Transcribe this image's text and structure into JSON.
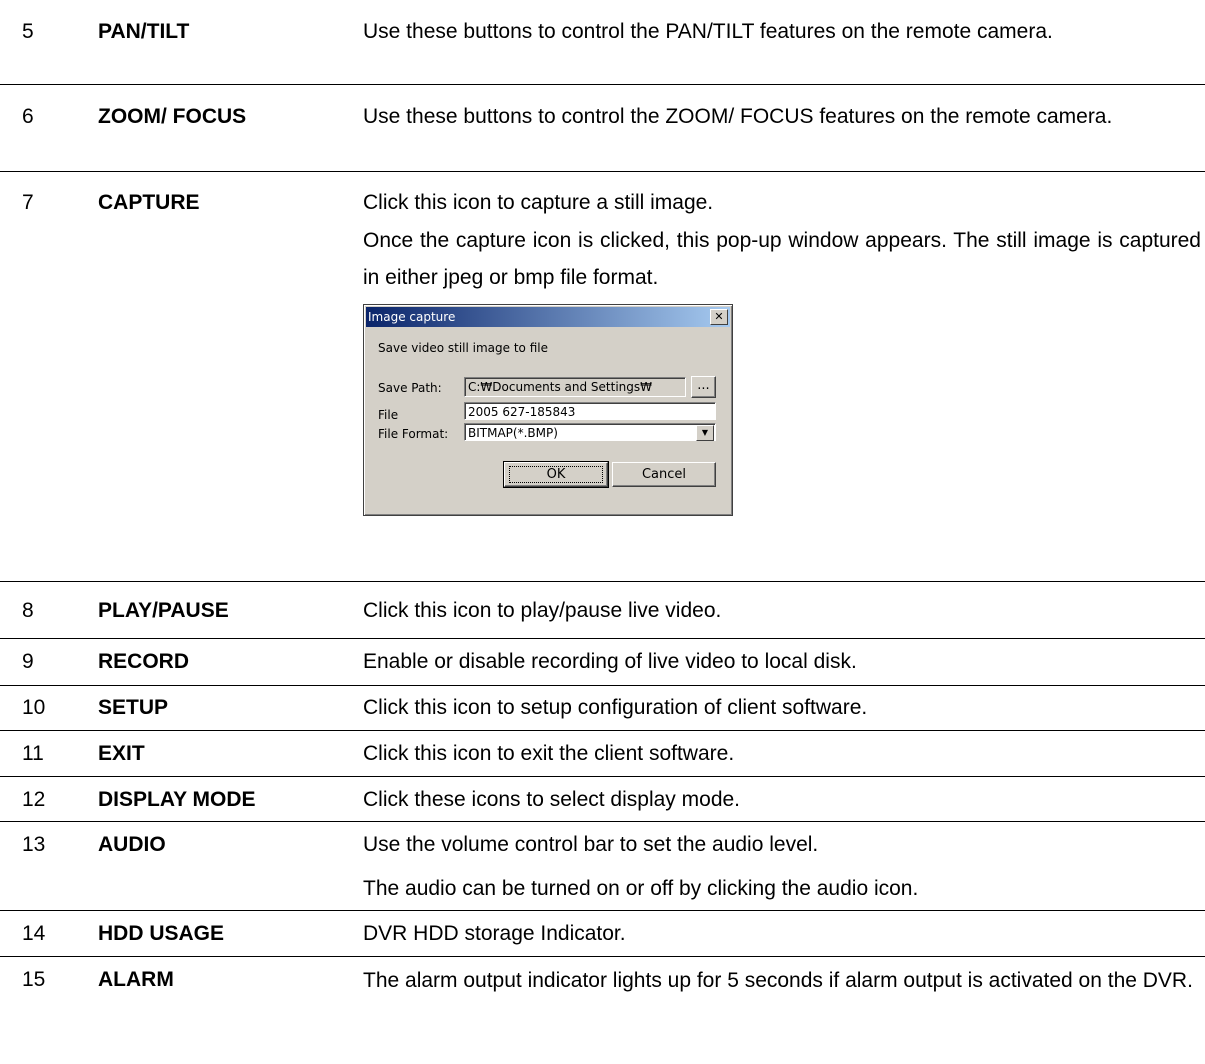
{
  "rows": [
    {
      "num": "5",
      "name": "PAN/TILT",
      "desc": [
        "Use these buttons to control the PAN/TILT features on the remote camera."
      ]
    },
    {
      "num": "6",
      "name": "ZOOM/ FOCUS",
      "desc": [
        "Use these buttons to control the ZOOM/ FOCUS features on the remote camera."
      ]
    },
    {
      "num": "7",
      "name": "CAPTURE",
      "desc": [
        "Click this icon to capture a still image.",
        "Once the capture icon is clicked, this pop-up window appears. The still image is captured in either jpeg or bmp file format."
      ]
    },
    {
      "num": "8",
      "name": "PLAY/PAUSE",
      "desc": [
        "Click this icon to play/pause live video."
      ]
    },
    {
      "num": "9",
      "name": "RECORD",
      "desc": [
        "Enable or disable recording of live video to local disk."
      ]
    },
    {
      "num": "10",
      "name": "SETUP",
      "desc": [
        "Click this icon to setup configuration of client software."
      ]
    },
    {
      "num": "11",
      "name": "EXIT",
      "desc": [
        "Click this icon to exit the client software."
      ]
    },
    {
      "num": "12",
      "name": "DISPLAY MODE",
      "desc": [
        "Click these icons to select display mode."
      ]
    },
    {
      "num": "13",
      "name": "AUDIO",
      "desc": [
        "Use the volume control bar to set the audio level.",
        "The audio can be turned on or off by clicking the audio icon."
      ]
    },
    {
      "num": "14",
      "name": "HDD USAGE",
      "desc": [
        "DVR HDD storage Indicator."
      ]
    },
    {
      "num": "15",
      "name": "ALARM",
      "desc": [
        "The alarm output indicator lights up for 5 seconds if alarm output is activated on the DVR."
      ]
    }
  ],
  "dialog": {
    "title": "Image capture",
    "close": "✕",
    "message": "Save video still image to file",
    "save_path_label": "Save Path:",
    "save_path_value": "C:₩Documents and Settings₩",
    "browse_label": "...",
    "file_label": "File",
    "file_value": "2005 627-185843",
    "format_label": "File Format:",
    "format_value": "BITMAP(*.BMP)",
    "ok_label": "OK",
    "cancel_label": "Cancel"
  }
}
